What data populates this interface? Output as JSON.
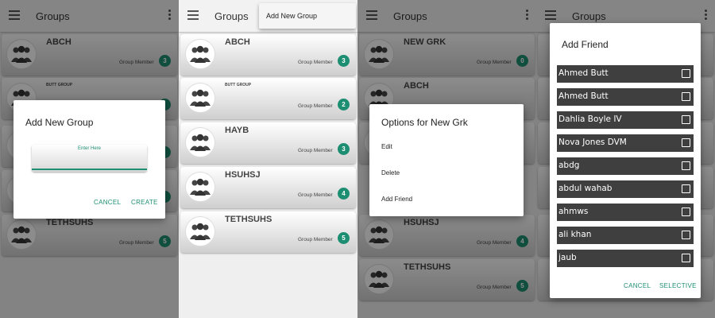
{
  "colors": {
    "accent": "#1e8e72",
    "friend_row": "#3f3f3f",
    "scrim": "rgba(0,0,0,0.45)"
  },
  "icons": {
    "menu": "hamburger-menu-icon",
    "more": "vertical-dots-icon",
    "avatar": "group-people-icon",
    "checkbox": "checkbox-empty-icon"
  },
  "panel1": {
    "appbar": {
      "title": "Groups"
    },
    "groups": [
      {
        "name": "ABCH",
        "sub": "Group Member",
        "count": "3"
      },
      {
        "name": "BUTT GROUP",
        "sub": "",
        "count": ""
      },
      {
        "name": "",
        "sub": "",
        "count": ""
      },
      {
        "name": "",
        "sub": "",
        "count": ""
      },
      {
        "name": "TETHSUHS",
        "sub": "Group Member",
        "count": "5"
      }
    ],
    "dialog": {
      "title": "Add New Group",
      "input_hint": "Enter Here",
      "cancel": "CANCEL",
      "create": "CREATE"
    }
  },
  "panel2": {
    "appbar": {
      "title": "Groups"
    },
    "menu": {
      "add_new_group": "Add New Group"
    },
    "groups": [
      {
        "name": "ABCH",
        "sub": "Group Member",
        "count": "3"
      },
      {
        "name": "BUTT GROUP",
        "sub": "Group Member",
        "count": "2"
      },
      {
        "name": "HAYB",
        "sub": "Group Member",
        "count": "3"
      },
      {
        "name": "HSUHSJ",
        "sub": "Group Member",
        "count": "4"
      },
      {
        "name": "TETHSUHS",
        "sub": "Group Member",
        "count": "5"
      }
    ]
  },
  "panel3": {
    "appbar": {
      "title": "Groups"
    },
    "groups": [
      {
        "name": "NEW GRK",
        "sub": "Group Member",
        "count": "0"
      },
      {
        "name": "ABCH",
        "sub": "",
        "count": ""
      },
      {
        "name": "",
        "sub": "",
        "count": ""
      },
      {
        "name": "HSUHSJ",
        "sub": "Group Member",
        "count": "4"
      },
      {
        "name": "TETHSUHS",
        "sub": "Group Member",
        "count": "5"
      }
    ],
    "dialog": {
      "title": "Options for New Grk",
      "edit": "Edit",
      "delete": "Delete",
      "add_friend": "Add Friend"
    }
  },
  "panel4": {
    "appbar": {
      "title": "Groups"
    },
    "dialog": {
      "title": "Add Friend",
      "friends": [
        "Ahmed Butt",
        "Ahmed Butt",
        "Dahlia Boyle IV",
        "Nova Jones DVM",
        "abdg",
        "abdul wahab",
        "ahmws",
        "ali khan",
        "jaub"
      ],
      "cancel": "CANCEL",
      "selective": "SELECTIVE"
    }
  }
}
